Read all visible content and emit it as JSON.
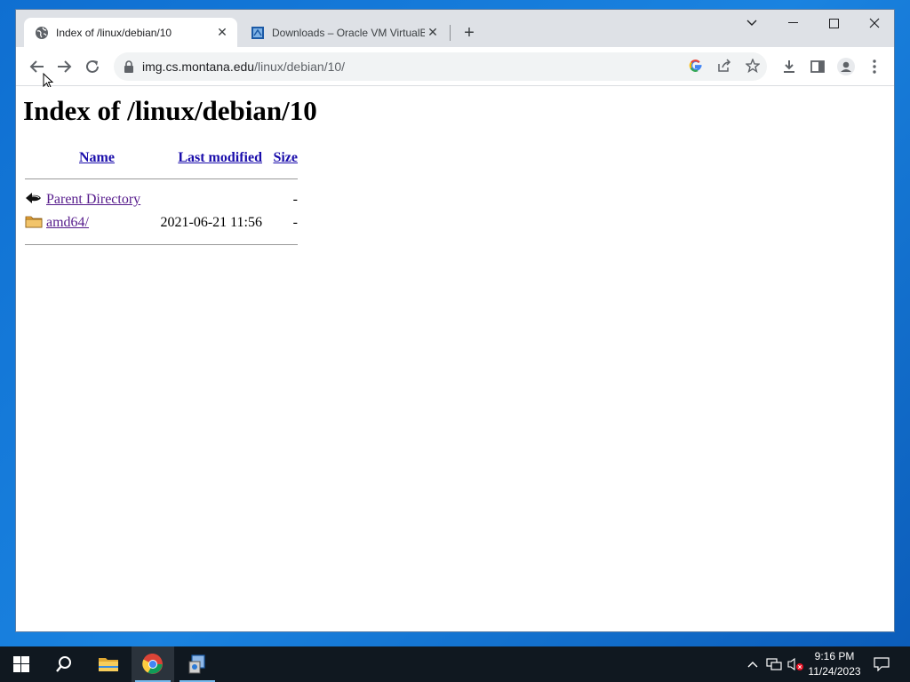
{
  "browser": {
    "tabs": [
      {
        "title": "Index of /linux/debian/10",
        "active": true
      },
      {
        "title": "Downloads – Oracle VM VirtualBox",
        "active": false
      }
    ],
    "new_tab_label": "+",
    "address_bar": {
      "host": "img.cs.montana.edu",
      "path": "/linux/debian/10/"
    }
  },
  "page": {
    "heading": "Index of /linux/debian/10",
    "columns": {
      "name": "Name",
      "last_modified": "Last modified",
      "size": "Size"
    },
    "rows": [
      {
        "icon": "back-icon",
        "name": "Parent Directory",
        "last_modified": "",
        "size": "-"
      },
      {
        "icon": "folder-icon",
        "name": "amd64/",
        "last_modified": "2021-06-21 11:56",
        "size": "-"
      }
    ]
  },
  "taskbar": {
    "items": [
      "start-icon",
      "search-icon",
      "file-explorer-icon",
      "chrome-icon",
      "installer-icon"
    ],
    "clock": {
      "time": "9:16 PM",
      "date": "11/24/2023"
    }
  },
  "colors": {
    "link": "#1a0dab",
    "visited": "#551a8b",
    "desktop": "#1a83e0",
    "taskbar": "#101820"
  }
}
